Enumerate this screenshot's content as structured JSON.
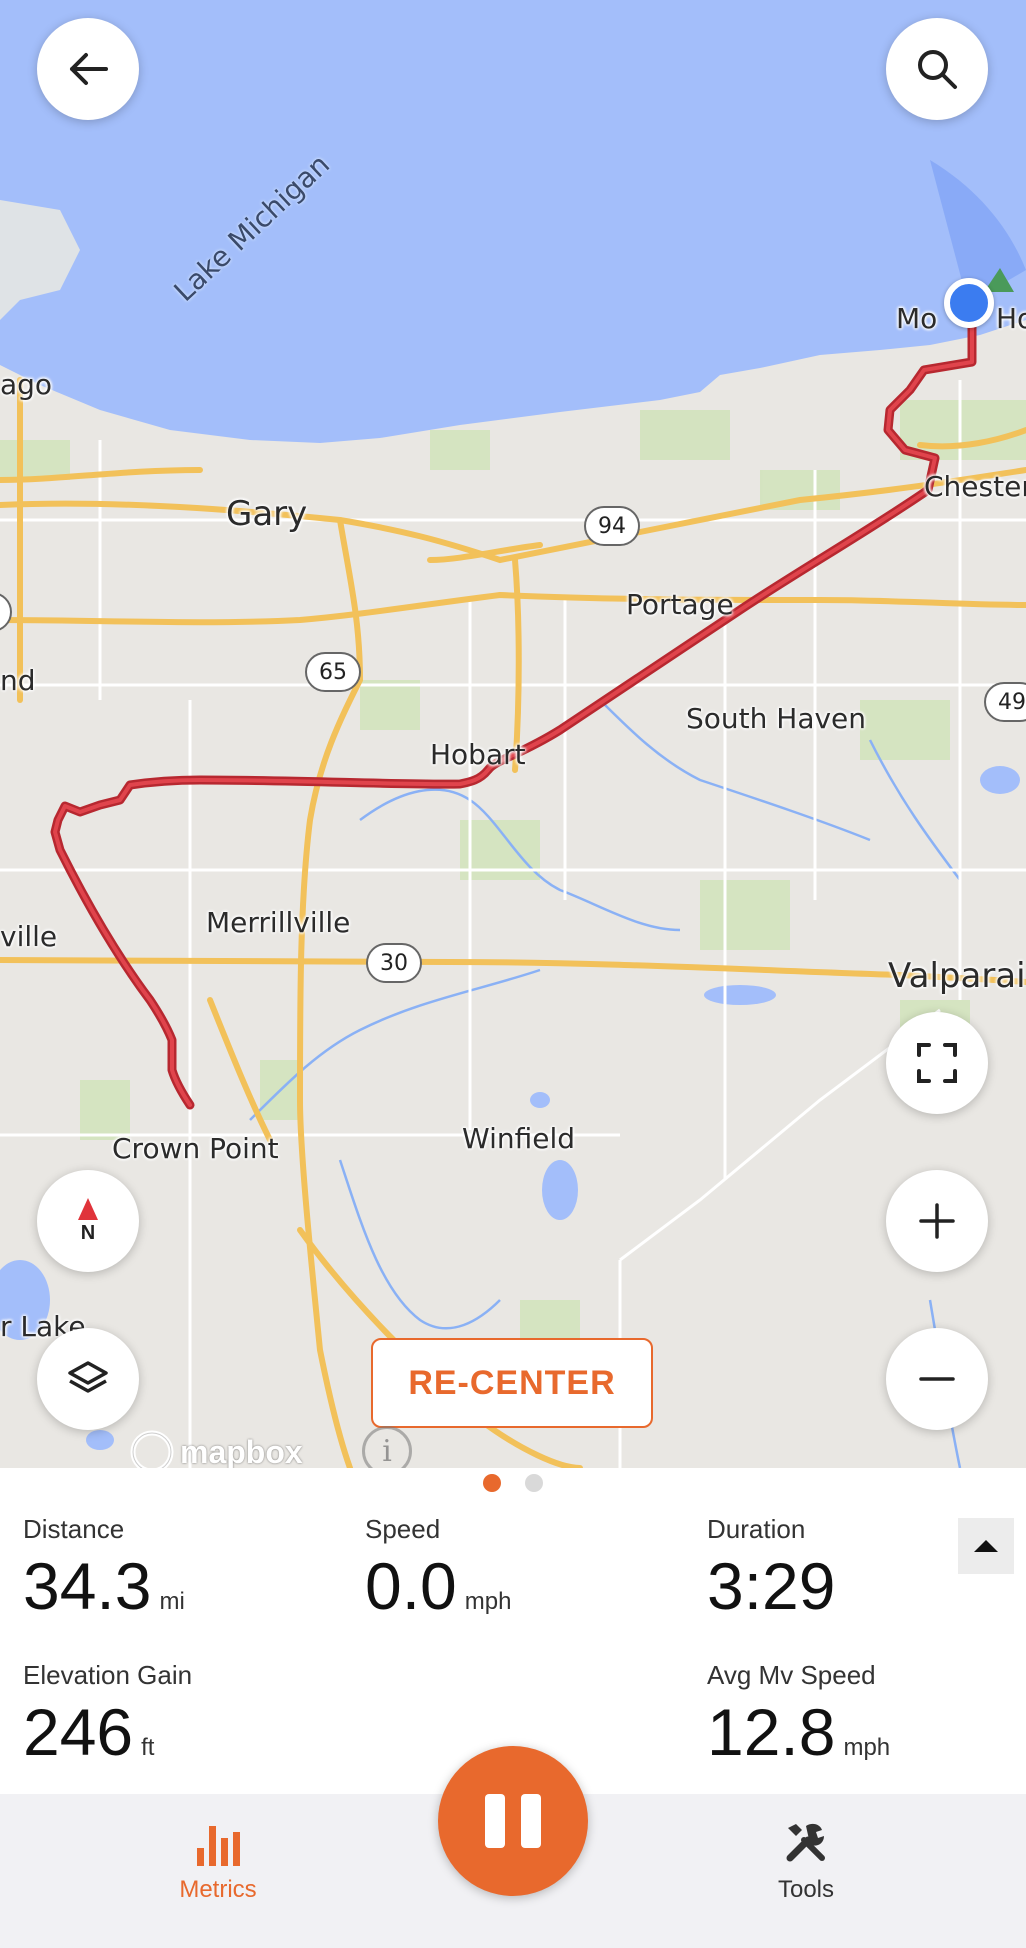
{
  "map": {
    "lake_label": "Lake Michigan",
    "places": {
      "chicago": "ago",
      "gary": "Gary",
      "mount_hope": "Mo",
      "mount_hope_tail": "Ho",
      "chesterton": "Chester",
      "portage": "Portage",
      "highland": "nd",
      "south_haven": "South Haven",
      "hobart": "Hobart",
      "merrillville": "Merrillville",
      "schererville": "ville",
      "valparaiso": "Valparai",
      "crown_point": "Crown Point",
      "winfield": "Winfield",
      "cedar_lake": "r Lake"
    },
    "shields": {
      "i94": "94",
      "i65": "65",
      "us30": "30",
      "us49": "49"
    },
    "colors": {
      "water": "#a3befa",
      "land": "#e9e7e3",
      "road": "#f2c15a",
      "route": "#d0323a",
      "location": "#3b7cf0"
    },
    "attribution": "mapbox",
    "recenter_label": "RE-CENTER"
  },
  "buttons": {
    "back": "back-arrow-icon",
    "search": "search-icon",
    "fullscreen": "fullscreen-icon",
    "zoom_in": "plus-icon",
    "zoom_out": "minus-icon",
    "compass_label": "N",
    "layers": "layers-icon"
  },
  "pager": {
    "pages": 2,
    "active": 0
  },
  "metrics": {
    "distance": {
      "label": "Distance",
      "value": "34.3",
      "unit": "mi"
    },
    "speed": {
      "label": "Speed",
      "value": "0.0",
      "unit": "mph"
    },
    "duration": {
      "label": "Duration",
      "value": "3:29",
      "unit": ""
    },
    "elevation": {
      "label": "Elevation Gain",
      "value": "246",
      "unit": "ft"
    },
    "avg_speed": {
      "label": "Avg Mv Speed",
      "value": "12.8",
      "unit": "mph"
    }
  },
  "tabs": {
    "metrics": {
      "label": "Metrics",
      "color": "#e8692d"
    },
    "tools": {
      "label": "Tools",
      "color": "#333333"
    }
  },
  "accent": "#e8692d"
}
